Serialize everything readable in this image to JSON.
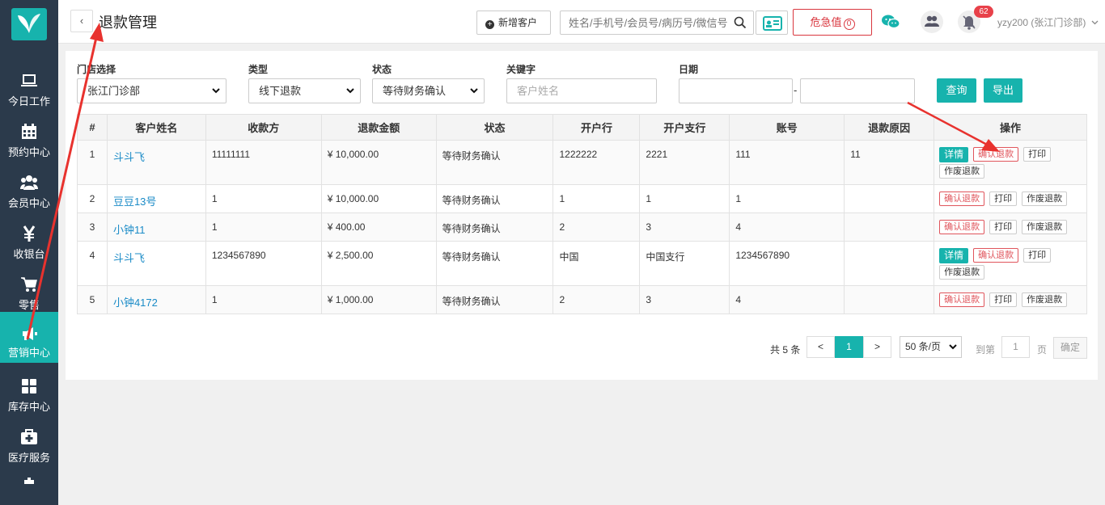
{
  "sidebar": {
    "items": [
      {
        "label": "今日工作",
        "icon": "laptop-icon"
      },
      {
        "label": "预约中心",
        "icon": "calendar-icon"
      },
      {
        "label": "会员中心",
        "icon": "users-icon"
      },
      {
        "label": "收银台",
        "icon": "yen-icon"
      },
      {
        "label": "零售",
        "icon": "cart-icon"
      },
      {
        "label": "营销中心",
        "icon": "megaphone-icon"
      },
      {
        "label": "库存中心",
        "icon": "grid-icon"
      },
      {
        "label": "医疗服务",
        "icon": "medkit-icon"
      }
    ],
    "active_index": 5
  },
  "header": {
    "back_glyph": "‹",
    "title": "退款管理",
    "add_customer": "新增客户",
    "search_placeholder": "姓名/手机号/会员号/病历号/微信号",
    "danger_label": "危急值",
    "danger_count": "0",
    "bell_badge": "62",
    "user": "yzy200 (张江门诊部)"
  },
  "filters": {
    "store_label": "门店选择",
    "store_value": "张江门诊部",
    "type_label": "类型",
    "type_value": "线下退款",
    "status_label": "状态",
    "status_value": "等待财务确认",
    "keyword_label": "关键字",
    "keyword_placeholder": "客户姓名",
    "date_label": "日期",
    "date_sep": "-",
    "query_button": "查询",
    "export_button": "导出"
  },
  "table": {
    "columns": [
      "#",
      "客户姓名",
      "收款方",
      "退款金额",
      "状态",
      "开户行",
      "开户支行",
      "账号",
      "退款原因",
      "操作"
    ],
    "rows": [
      {
        "idx": "1",
        "name": "斗斗飞",
        "payee": "11111111",
        "amount": "¥ 10,000.00",
        "status": "等待财务确认",
        "bank": "1222222",
        "branch": "2221",
        "account": "111",
        "reason": "11",
        "has_detail": true
      },
      {
        "idx": "2",
        "name": "豆豆13号",
        "payee": "1",
        "amount": "¥ 10,000.00",
        "status": "等待财务确认",
        "bank": "1",
        "branch": "1",
        "account": "1",
        "reason": "",
        "has_detail": false
      },
      {
        "idx": "3",
        "name": "小钟11",
        "payee": "1",
        "amount": "¥ 400.00",
        "status": "等待财务确认",
        "bank": "2",
        "branch": "3",
        "account": "4",
        "reason": "",
        "has_detail": false
      },
      {
        "idx": "4",
        "name": "斗斗飞",
        "payee": "1234567890",
        "amount": "¥ 2,500.00",
        "status": "等待财务确认",
        "bank": "中国",
        "branch": "中国支行",
        "account": "1234567890",
        "reason": "",
        "has_detail": true
      },
      {
        "idx": "5",
        "name": "小钟4172",
        "payee": "1",
        "amount": "¥ 1,000.00",
        "status": "等待财务确认",
        "bank": "2",
        "branch": "3",
        "account": "4",
        "reason": "",
        "has_detail": false
      }
    ],
    "actions": {
      "detail": "详情",
      "confirm": "确认退款",
      "print": "打印",
      "void": "作废退款"
    }
  },
  "pagination": {
    "total": "共 5 条",
    "prev": "<",
    "current": "1",
    "next": ">",
    "page_size": "50 条/页",
    "goto_prefix": "到第",
    "goto_value": "1",
    "goto_suffix": "页",
    "confirm": "确定"
  },
  "colors": {
    "sidebar_bg": "#2b3a4b",
    "accent": "#17b3ad",
    "danger": "#d9363e",
    "link": "#1a8bc7",
    "annotation_arrow": "#e8322e"
  }
}
